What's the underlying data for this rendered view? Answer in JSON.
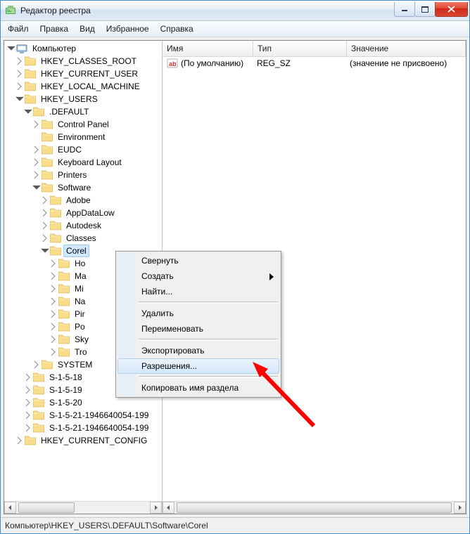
{
  "window": {
    "title": "Редактор реестра"
  },
  "menu": {
    "file": "Файл",
    "edit": "Правка",
    "view": "Вид",
    "favorites": "Избранное",
    "help": "Справка"
  },
  "tree": {
    "root": "Компьютер",
    "hives": {
      "hkcr": "HKEY_CLASSES_ROOT",
      "hkcu": "HKEY_CURRENT_USER",
      "hklm": "HKEY_LOCAL_MACHINE",
      "hku": "HKEY_USERS",
      "hkcc": "HKEY_CURRENT_CONFIG"
    },
    "hku_children": {
      "default": ".DEFAULT",
      "s1": "S-1-5-18",
      "s2": "S-1-5-19",
      "s3": "S-1-5-20",
      "s4": "S-1-5-21-1946640054-199",
      "s5": "S-1-5-21-1946640054-199"
    },
    "default_children": {
      "control_panel": "Control Panel",
      "environment": "Environment",
      "eudc": "EUDC",
      "keyboard_layout": "Keyboard Layout",
      "printers": "Printers",
      "software": "Software",
      "system": "SYSTEM"
    },
    "software_children": {
      "adobe": "Adobe",
      "appdatalow": "AppDataLow",
      "autodesk": "Autodesk",
      "classes": "Classes",
      "corel": "Corel",
      "ho": "Ho",
      "ma": "Ma",
      "mi": "Mi",
      "na": "Na",
      "pir": "Pir",
      "po": "Po",
      "sky": "Sky",
      "tro": "Tro"
    }
  },
  "list": {
    "headers": {
      "name": "Имя",
      "type": "Тип",
      "value": "Значение"
    },
    "row0": {
      "name": "(По умолчанию)",
      "type": "REG_SZ",
      "value": "(значение не присвоено)"
    }
  },
  "context_menu": {
    "collapse": "Свернуть",
    "new": "Создать",
    "find": "Найти...",
    "delete": "Удалить",
    "rename": "Переименовать",
    "export": "Экспортировать",
    "permissions": "Разрешения...",
    "copy_key_name": "Копировать имя раздела"
  },
  "statusbar": {
    "path": "Компьютер\\HKEY_USERS\\.DEFAULT\\Software\\Corel"
  }
}
